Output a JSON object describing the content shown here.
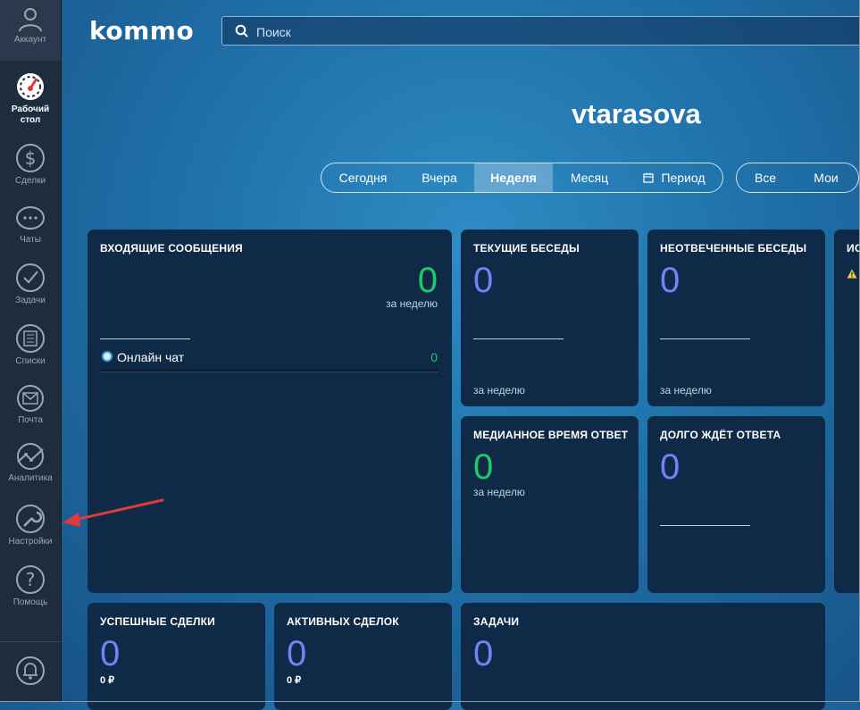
{
  "sidebar": {
    "items": [
      {
        "label": "Аккаунт",
        "icon": "user-icon"
      },
      {
        "label": "Рабочий стол",
        "icon": "dashboard-icon"
      },
      {
        "label": "Сделки",
        "icon": "dollar-icon"
      },
      {
        "label": "Чаты",
        "icon": "chat-icon"
      },
      {
        "label": "Задачи",
        "icon": "check-icon"
      },
      {
        "label": "Списки",
        "icon": "list-icon"
      },
      {
        "label": "Почта",
        "icon": "mail-icon"
      },
      {
        "label": "Аналитика",
        "icon": "analytics-icon"
      },
      {
        "label": "Настройки",
        "icon": "wrench-icon"
      },
      {
        "label": "Помощь",
        "icon": "help-icon"
      }
    ],
    "dashboard_line1": "Рабочий",
    "dashboard_line2": "стол",
    "notifications_icon": "bell-icon"
  },
  "header": {
    "logo": "kommo",
    "search_placeholder": "Поиск"
  },
  "username": "vtarasova",
  "period_filters": [
    "Сегодня",
    "Вчера",
    "Неделя",
    "Месяц",
    "Период"
  ],
  "active_period": "Неделя",
  "owner_filters": [
    "Все",
    "Мои"
  ],
  "colors": {
    "green": "#1ec96b",
    "blue": "#7b7df5",
    "card": "#0e2a47",
    "arrow": "#e03a3a"
  },
  "widgets": {
    "incoming": {
      "title": "ВХОДЯЩИЕ СООБЩЕНИЯ",
      "value": "0",
      "period": "за неделю",
      "source_label": "Онлайн чат",
      "source_value": "0"
    },
    "current_chats": {
      "title": "ТЕКУЩИЕ БЕСЕДЫ",
      "value": "0",
      "period": "за неделю"
    },
    "unanswered_chats": {
      "title": "НЕОТВЕЧЕННЫЕ БЕСЕДЫ",
      "value": "0",
      "period": "за неделю"
    },
    "partial_card": {
      "title": "ИС"
    },
    "median_response": {
      "title": "МЕДИАННОЕ ВРЕМЯ ОТВЕТ",
      "value": "0",
      "period": "за неделю"
    },
    "long_waiting": {
      "title": "ДОЛГО ЖДЁТ ОТВЕТА",
      "value": "0"
    },
    "won_deals": {
      "title": "УСПЕШНЫЕ СДЕЛКИ",
      "value": "0",
      "amount": "0 ₽"
    },
    "active_deals": {
      "title": "АКТИВНЫХ СДЕЛОК",
      "value": "0",
      "amount": "0 ₽"
    },
    "tasks": {
      "title": "ЗАДАЧИ",
      "value": "0"
    }
  }
}
